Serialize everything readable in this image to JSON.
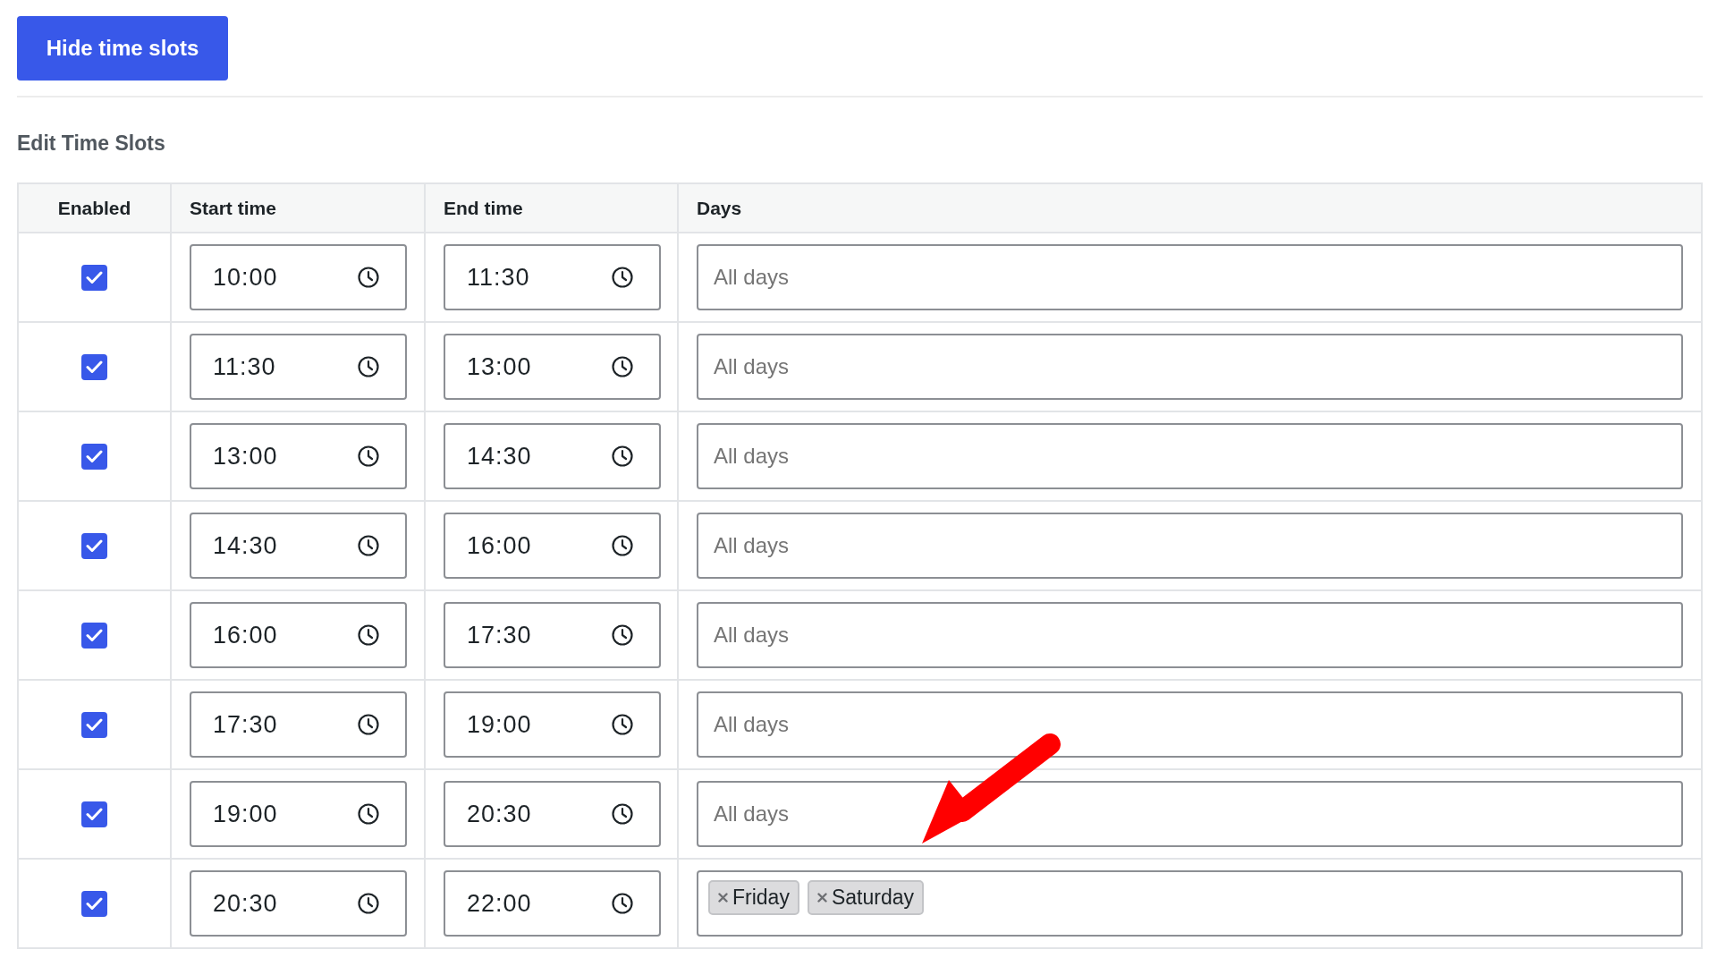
{
  "toolbar": {
    "button": "Hide time slots"
  },
  "section": {
    "title": "Edit Time Slots"
  },
  "table": {
    "columns": [
      "Enabled",
      "Start time",
      "End time",
      "Days"
    ],
    "rows": [
      {
        "enabled": true,
        "start": "10:00",
        "end": "11:30",
        "days": {
          "placeholder": "All days"
        }
      },
      {
        "enabled": true,
        "start": "11:30",
        "end": "13:00",
        "days": {
          "placeholder": "All days"
        }
      },
      {
        "enabled": true,
        "start": "13:00",
        "end": "14:30",
        "days": {
          "placeholder": "All days"
        }
      },
      {
        "enabled": true,
        "start": "14:30",
        "end": "16:00",
        "days": {
          "placeholder": "All days"
        }
      },
      {
        "enabled": true,
        "start": "16:00",
        "end": "17:30",
        "days": {
          "placeholder": "All days"
        }
      },
      {
        "enabled": true,
        "start": "17:30",
        "end": "19:00",
        "days": {
          "placeholder": "All days"
        }
      },
      {
        "enabled": true,
        "start": "19:00",
        "end": "20:30",
        "days": {
          "placeholder": "All days"
        }
      },
      {
        "enabled": true,
        "start": "20:30",
        "end": "22:00",
        "days": {
          "tags": [
            "Friday",
            "Saturday"
          ]
        }
      }
    ]
  }
}
